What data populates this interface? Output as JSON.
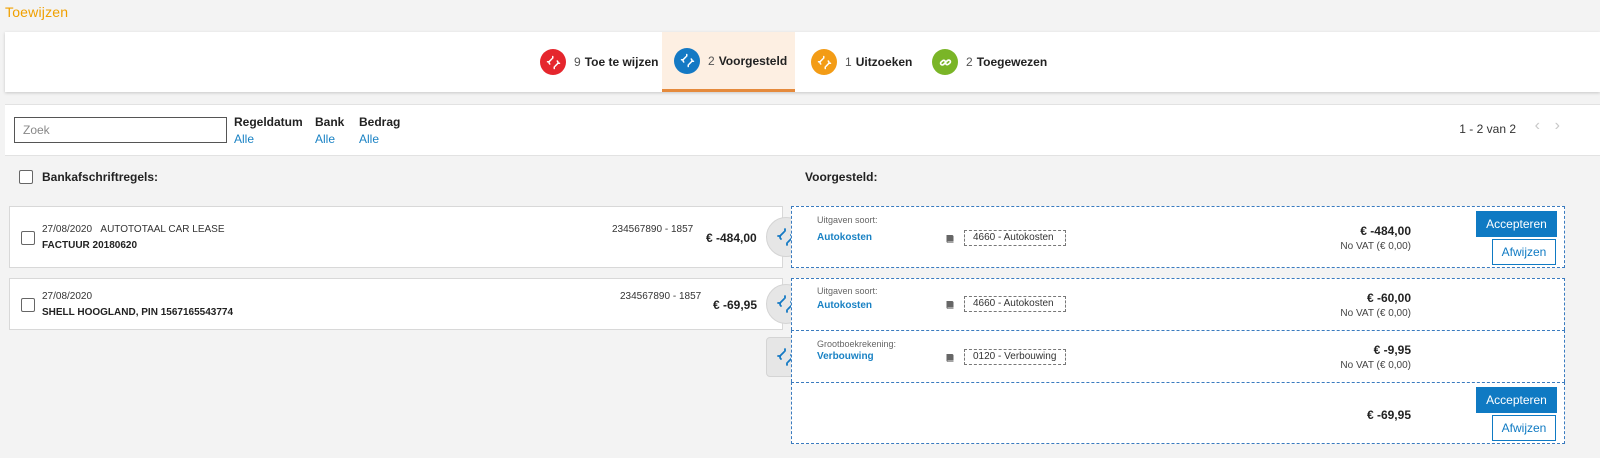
{
  "page": {
    "title": "Toewijzen"
  },
  "tabs": [
    {
      "count": "9",
      "label": "Toe te wijzen",
      "color": "#e5262d"
    },
    {
      "count": "2",
      "label": "Voorgesteld",
      "color": "#1479c4"
    },
    {
      "count": "1",
      "label": "Uitzoeken",
      "color": "#f39c16"
    },
    {
      "count": "2",
      "label": "Toegewezen",
      "color": "#7ab527"
    }
  ],
  "active_tab": "Voorgesteld",
  "filters": {
    "search_placeholder": "Zoek",
    "items": [
      {
        "label": "Regeldatum",
        "value": "Alle"
      },
      {
        "label": "Bank",
        "value": "Alle"
      },
      {
        "label": "Bedrag",
        "value": "Alle"
      }
    ],
    "pagination": "1 - 2 van 2"
  },
  "left_header": "Bankafschriftregels:",
  "right_header": "Voorgesteld:",
  "bank_lines": [
    {
      "date": "27/08/2020",
      "party": "AUTOTOTAAL CAR LEASE",
      "desc": "FACTUUR 20180620",
      "account": "234567890 - 1857",
      "amount": "€ -484,00"
    },
    {
      "date": "27/08/2020",
      "party": "",
      "desc": "SHELL HOOGLAND, PIN 1567165543774",
      "account": "234567890 - 1857",
      "amount": "€ -69,95"
    }
  ],
  "suggestions": [
    {
      "caption": "Uitgaven soort:",
      "link": "Autokosten",
      "account": "4660 - Autokosten",
      "amount": "€ -484,00",
      "vat": "No VAT (€ 0,00)"
    },
    {
      "caption": "Uitgaven soort:",
      "link": "Autokosten",
      "account": "4660 - Autokosten",
      "amount": "€ -60,00",
      "vat": "No VAT (€ 0,00)"
    },
    {
      "caption": "Grootboekrekening:",
      "link": "Verbouwing",
      "account": "0120 - Verbouwing",
      "amount": "€ -9,95",
      "vat": "No VAT (€ 0,00)"
    },
    {
      "total": "€ -69,95"
    }
  ],
  "buttons": {
    "accept": "Accepteren",
    "reject": "Afwijzen"
  },
  "colors": {
    "accent_blue": "#0f7ac3",
    "link_blue": "#1a82c4",
    "title_orange": "#f0a000",
    "tab_underline": "#e58a3c"
  },
  "icons": {
    "link": "broken-link-icon",
    "linked": "link-icon",
    "book": "book-icon",
    "prev": "chevron-left-icon",
    "next": "chevron-right-icon"
  }
}
